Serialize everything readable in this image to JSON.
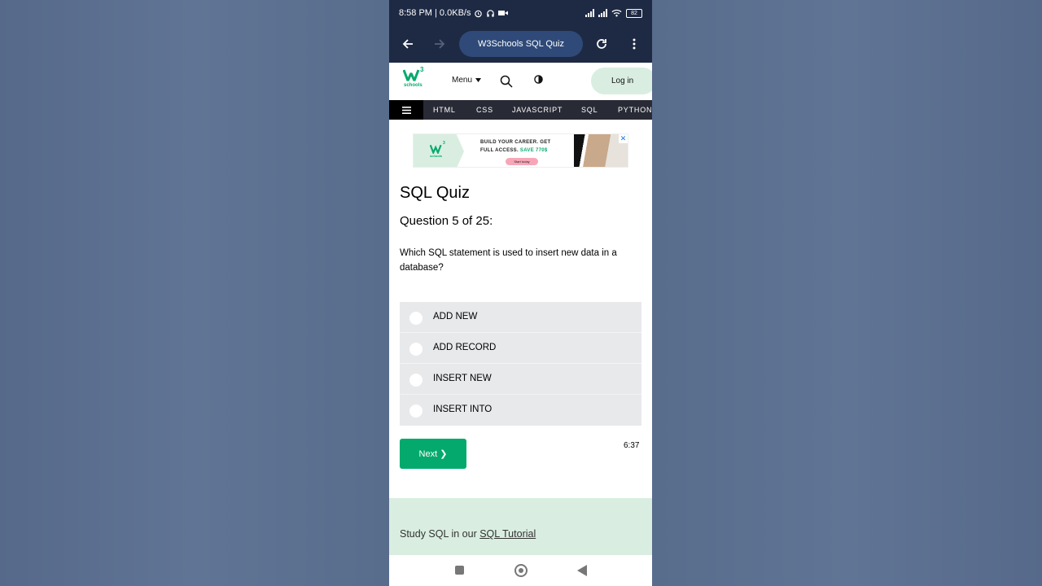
{
  "status_bar": {
    "time_speed": "8:58 PM | 0.0KB/s",
    "battery": "82",
    "icons": [
      "alarm-icon",
      "headphones-icon",
      "video-icon",
      "signal-icon",
      "signal-icon",
      "wifi-icon",
      "battery-icon"
    ]
  },
  "browser": {
    "tab_title": "W3Schools SQL Quiz",
    "icons": [
      "back-arrow-icon",
      "forward-arrow-icon",
      "reload-icon",
      "more-vert-icon"
    ]
  },
  "header": {
    "logo_text": "schools",
    "logo_superscript": "3",
    "menu_label": "Menu",
    "login_label": "Log in",
    "icons": [
      "w3-logo-icon",
      "caret-down-icon",
      "search-icon",
      "contrast-icon"
    ]
  },
  "topnav": {
    "items": [
      "HTML",
      "CSS",
      "JAVASCRIPT",
      "SQL",
      "PYTHON"
    ],
    "icons": [
      "hamburger-icon"
    ]
  },
  "ad": {
    "line1": "BUILD YOUR CAREER. GET",
    "line2_a": "FULL ACCESS.",
    "line2_b": "SAVE 770$",
    "cta": "Start today",
    "logo_text": "schools",
    "logo_superscript": "3",
    "close_glyph": "✕",
    "icons": [
      "ad-close-icon"
    ]
  },
  "quiz": {
    "title": "SQL Quiz",
    "question_number": "Question 5 of 25:",
    "question_text": "Which SQL statement is used to insert new data in a database?",
    "options": [
      "ADD NEW",
      "ADD RECORD",
      "INSERT NEW",
      "INSERT INTO"
    ],
    "next_label": "Next ❯",
    "timer": "6:37"
  },
  "study": {
    "prefix": "Study SQL in our",
    "link": "SQL Tutorial"
  },
  "android_nav": {
    "icons": [
      "recents-icon",
      "home-icon",
      "back-icon"
    ]
  },
  "colors": {
    "background": "#5b6f8e",
    "browser_bar": "#1e2a44",
    "url_pill": "#2f4a78",
    "w3_green": "#04aa6d",
    "w3_light_green": "#d9eee1",
    "topnav": "#282a35",
    "option_bg": "#e7e9eb"
  }
}
